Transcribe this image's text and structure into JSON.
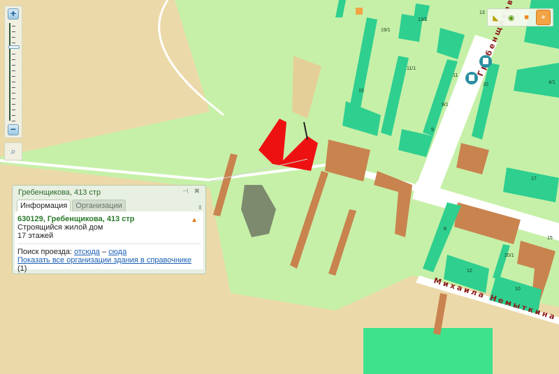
{
  "map": {
    "house_numbers": [
      "13",
      "13/1",
      "19/1",
      "11/1",
      "15",
      "11",
      "9/1",
      "9",
      "10",
      "4/1",
      "17",
      "8",
      "20/1",
      "12",
      "10",
      "15"
    ],
    "streets": {
      "vertical": "Гребенщикова",
      "horizontal": "Михаила Немыткина"
    }
  },
  "zoom_control": {
    "zoom_in": "+",
    "zoom_out": "−",
    "level_fraction": 0.22
  },
  "toolbar": {
    "tools": [
      {
        "name": "ruler-icon",
        "glyph": "📏"
      },
      {
        "name": "layers-icon",
        "glyph": "◉"
      },
      {
        "name": "area-icon",
        "glyph": "■"
      },
      {
        "name": "select-icon",
        "glyph": "⌖"
      }
    ]
  },
  "popup": {
    "title": "Гребенщикова, 413 стр",
    "pin": "⊣",
    "close": "✖",
    "tabs": [
      "Информация",
      "Организации"
    ],
    "tab_menu": "⇟",
    "address": "630129, Гребенщикова, 413 стр",
    "description": "Строящийся жилой дом",
    "floors": "17 этажей",
    "route_label": "Поиск проезда:",
    "route_from": "отсюда",
    "route_dash": "–",
    "route_to": "сюда",
    "show_orgs": "Показать все организации здания в справочнике",
    "org_count": "(1)",
    "warning": "▲"
  },
  "colors": {
    "tan": "#ecd9a9",
    "green": "#c6f0a8",
    "building": "#2fcf8f",
    "orange": "#c9834f",
    "red": "#ee1111"
  }
}
